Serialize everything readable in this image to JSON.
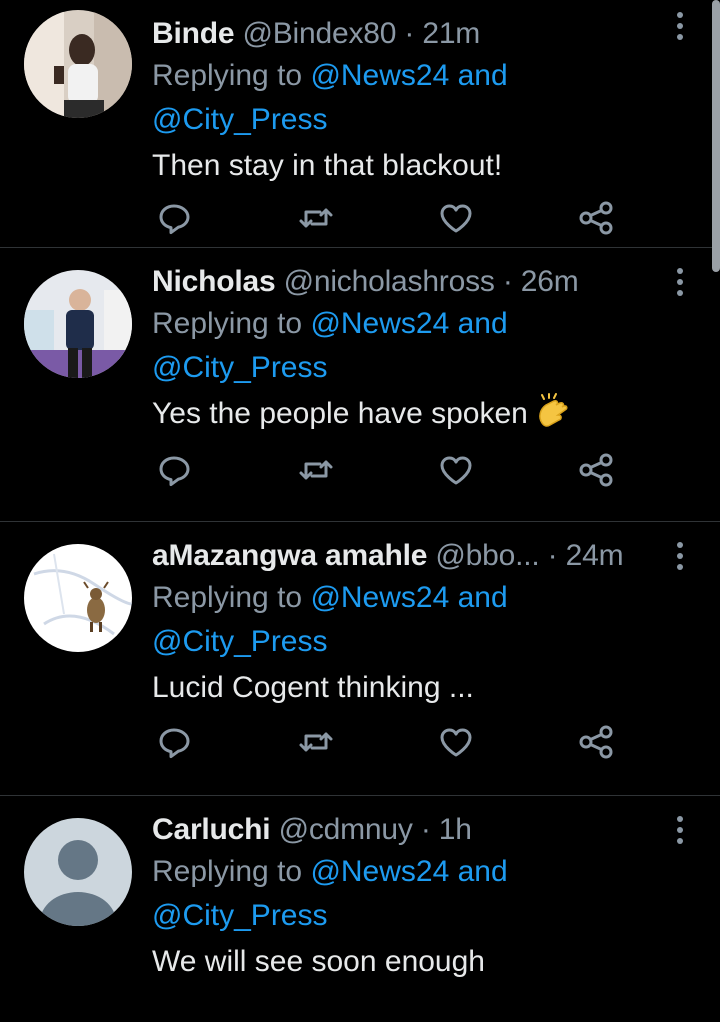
{
  "tweets": [
    {
      "name": "Binde",
      "handle": "@Bindex80",
      "separator": "·",
      "time": "21m",
      "replying_prefix": "Replying to ",
      "mention_1": "@News24",
      "mention_joiner": " and",
      "mention_2": "@City_Press",
      "text": "Then stay in that blackout!",
      "emoji": ""
    },
    {
      "name": "Nicholas",
      "handle": "@nicholashross",
      "separator": "·",
      "time": "26m",
      "replying_prefix": "Replying to ",
      "mention_1": "@News24",
      "mention_joiner": " and",
      "mention_2": "@City_Press",
      "text": "Yes the people have spoken",
      "emoji": "clapping-hands"
    },
    {
      "name": "aMazangwa amahle",
      "handle": "@bbo...",
      "separator": "·",
      "time": "24m",
      "replying_prefix": "Replying to ",
      "mention_1": "@News24",
      "mention_joiner": " and",
      "mention_2": "@City_Press",
      "text": "Lucid Cogent thinking ...",
      "emoji": ""
    },
    {
      "name": "Carluchi",
      "handle": "@cdmnuy",
      "separator": "·",
      "time": "1h",
      "replying_prefix": "Replying to ",
      "mention_1": "@News24",
      "mention_joiner": " and",
      "mention_2": "@City_Press",
      "text": "We will see soon enough",
      "emoji": ""
    }
  ],
  "icons": {
    "reply": "reply-icon",
    "retweet": "retweet-icon",
    "like": "heart-icon",
    "share": "share-icon",
    "more": "more-vertical-icon"
  },
  "colors": {
    "background": "#000000",
    "text": "#e7e9ea",
    "muted": "#8b98a5",
    "link": "#1d9bf0",
    "divider": "#2f3336"
  }
}
